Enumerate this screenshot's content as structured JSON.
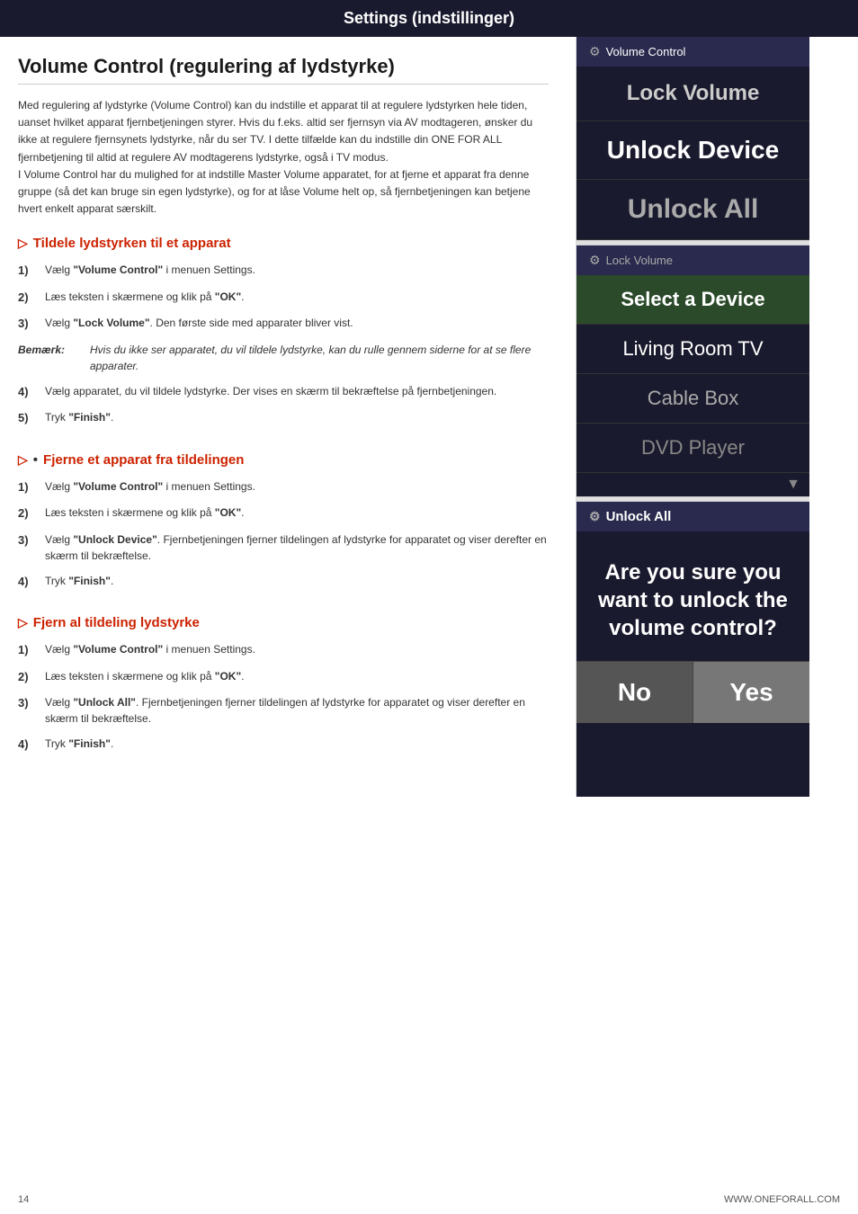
{
  "header": {
    "title": "Settings (indstillinger)"
  },
  "page": {
    "section_title": "Volume Control (regulering af lydstyrke)",
    "intro": "Med regulering af lydstyrke (Volume Control) kan du indstille et apparat til at regulere lydstyrken hele tiden, uanset hvilket apparat fjernbetjeningen styrer.  Hvis du f.eks. altid ser fjernsyn via AV modtageren, ønsker du ikke at regulere fjernsynets lydstyrke, når du ser TV. I dette tilfælde kan du indstille din ONE FOR ALL fjernbetjening til altid at regulere AV modtagerens lydstyrke, også i TV modus.\nI Volume Control har du mulighed for at indstille Master Volume apparatet, for at fjerne et apparat fra denne gruppe (så det kan bruge sin egen lydstyrke), og for at låse Volume helt op, så fjernbetjeningen kan betjene hvert enkelt apparat særskilt.",
    "subsections": [
      {
        "id": "tildele",
        "title": "Tildele lydstyrken til et apparat",
        "steps": [
          {
            "num": "1)",
            "text": "Vælg \"Volume Control\" i menuen Settings."
          },
          {
            "num": "2)",
            "text": "Læs teksten i skærmene og klik på \"OK\"."
          },
          {
            "num": "3)",
            "text": "Vælg \"Lock Volume\". Den første side med apparater bliver vist."
          },
          {
            "num": "note",
            "label": "Bemærk:",
            "text": "Hvis du ikke ser apparatet, du vil tildele lydstyrke, kan du rulle gennem siderne for at se flere apparater."
          },
          {
            "num": "4)",
            "text": "Vælg apparatet, du vil tildele lydstyrke. Der vises en skærm til bekræftelse på fjernbetjeningen."
          },
          {
            "num": "5)",
            "text": "Tryk \"Finish\"."
          }
        ]
      },
      {
        "id": "fjerne-apparat",
        "title": "Fjerne et apparat fra tildelingen",
        "steps": [
          {
            "num": "1)",
            "text": "Vælg \"Volume Control\" i menuen Settings."
          },
          {
            "num": "2)",
            "text": "Læs teksten i skærmene og klik på \"OK\"."
          },
          {
            "num": "3)",
            "text": "Vælg \"Unlock Device\". Fjernbetjeningen fjerner tildelingen af lydstyrke for apparatet og viser derefter en skærm til bekræftelse."
          },
          {
            "num": "4)",
            "text": "Tryk \"Finish\"."
          }
        ]
      },
      {
        "id": "fjern-al",
        "title": "Fjern al tildeling lydstyrke",
        "steps": [
          {
            "num": "1)",
            "text": "Vælg \"Volume Control\" i menuen Settings."
          },
          {
            "num": "2)",
            "text": "Læs teksten i skærmene og klik på \"OK\"."
          },
          {
            "num": "3)",
            "text": "Vælg \"Unlock All\". Fjernbetjeningen fjerner tildelingen af lydstyrke for apparatet og viser derefter en skærm til bekræftelse."
          },
          {
            "num": "4)",
            "text": "Tryk \"Finish\"."
          }
        ]
      }
    ]
  },
  "right_panel": {
    "screen1": {
      "header": "Volume Control",
      "items": [
        "Lock Volume",
        "Unlock Device",
        "Unlock All"
      ]
    },
    "screen2": {
      "header": "Lock Volume",
      "select_device": "Select a Device",
      "devices": [
        "Living Room TV",
        "Cable Box",
        "DVD Player"
      ]
    },
    "screen3": {
      "header": "Unlock All",
      "confirm_text": "Are you sure you want to unlock the volume control?",
      "btn_no": "No",
      "btn_yes": "Yes"
    }
  },
  "footer": {
    "page_num": "14",
    "website": "WWW.ONEFORALL.COM"
  }
}
